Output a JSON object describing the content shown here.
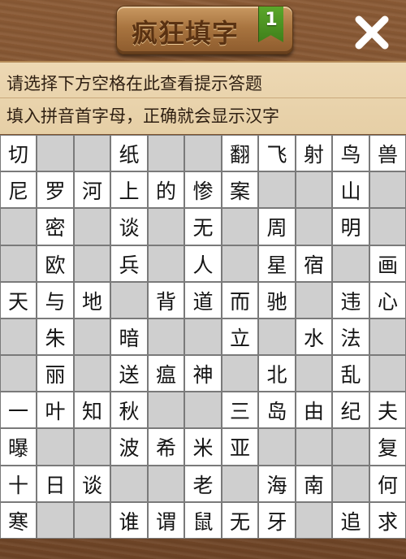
{
  "header": {
    "title": "疯狂填字",
    "level": "1",
    "close_icon": "close-icon"
  },
  "hints": {
    "line1": "请选择下方空格在此查看提示答题",
    "line2": "填入拼音首字母，正确就会显示汉字"
  },
  "grid": {
    "rows": [
      [
        "切",
        "",
        "",
        "纸",
        "",
        "",
        "翻",
        "飞",
        "射",
        "鸟",
        "兽"
      ],
      [
        "尼",
        "罗",
        "河",
        "上",
        "的",
        "惨",
        "案",
        "",
        "",
        "山",
        ""
      ],
      [
        "",
        "密",
        "",
        "谈",
        "",
        "无",
        "",
        "周",
        "",
        "明",
        ""
      ],
      [
        "",
        "欧",
        "",
        "兵",
        "",
        "人",
        "",
        "星",
        "宿",
        "",
        "画"
      ],
      [
        "天",
        "与",
        "地",
        "",
        "背",
        "道",
        "而",
        "驰",
        "",
        "违",
        "心"
      ],
      [
        "",
        "朱",
        "",
        "暗",
        "",
        "",
        "立",
        "",
        "水",
        "法",
        ""
      ],
      [
        "",
        "丽",
        "",
        "送",
        "瘟",
        "神",
        "",
        "北",
        "",
        "乱",
        ""
      ],
      [
        "一",
        "叶",
        "知",
        "秋",
        "",
        "",
        "三",
        "岛",
        "由",
        "纪",
        "夫"
      ],
      [
        "曝",
        "",
        "",
        "波",
        "希",
        "米",
        "亚",
        "",
        "",
        "",
        "复"
      ],
      [
        "十",
        "日",
        "谈",
        "",
        "",
        "老",
        "",
        "海",
        "南",
        "",
        "何"
      ],
      [
        "寒",
        "",
        "",
        "谁",
        "谓",
        "鼠",
        "无",
        "牙",
        "",
        "追",
        "求"
      ]
    ],
    "shaded": [
      [
        0,
        1,
        1,
        0,
        1,
        1,
        0,
        0,
        0,
        0,
        0
      ],
      [
        0,
        0,
        0,
        0,
        0,
        0,
        0,
        1,
        1,
        0,
        1
      ],
      [
        1,
        0,
        1,
        0,
        1,
        0,
        1,
        0,
        1,
        0,
        1
      ],
      [
        1,
        0,
        1,
        0,
        1,
        0,
        1,
        0,
        0,
        1,
        0
      ],
      [
        0,
        0,
        0,
        1,
        0,
        0,
        0,
        0,
        1,
        0,
        0
      ],
      [
        1,
        0,
        1,
        0,
        1,
        1,
        0,
        1,
        0,
        0,
        1
      ],
      [
        1,
        0,
        1,
        0,
        0,
        0,
        1,
        0,
        1,
        0,
        1
      ],
      [
        0,
        0,
        0,
        0,
        1,
        1,
        0,
        0,
        0,
        0,
        0
      ],
      [
        0,
        1,
        1,
        0,
        0,
        0,
        0,
        1,
        1,
        1,
        0
      ],
      [
        0,
        0,
        0,
        1,
        1,
        0,
        1,
        0,
        0,
        1,
        0
      ],
      [
        0,
        1,
        1,
        0,
        0,
        0,
        0,
        0,
        1,
        0,
        0
      ]
    ]
  }
}
